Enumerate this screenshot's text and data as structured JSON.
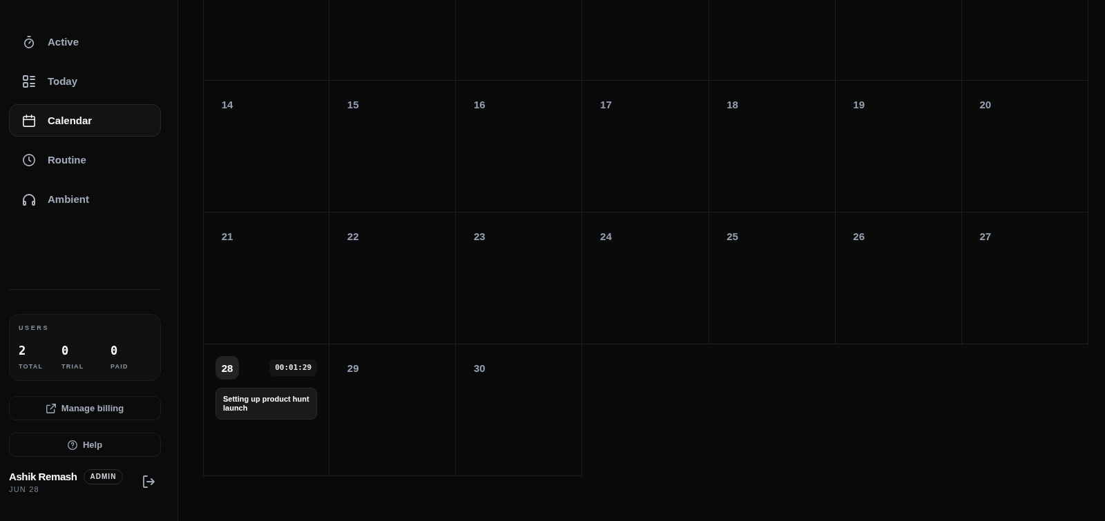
{
  "sidebar": {
    "nav": [
      {
        "label": "Active",
        "selected": false
      },
      {
        "label": "Today",
        "selected": false
      },
      {
        "label": "Calendar",
        "selected": true
      },
      {
        "label": "Routine",
        "selected": false
      },
      {
        "label": "Ambient",
        "selected": false
      }
    ],
    "users": {
      "title": "USERS",
      "stats": [
        {
          "value": "2",
          "label": "TOTAL"
        },
        {
          "value": "0",
          "label": "TRIAL"
        },
        {
          "value": "0",
          "label": "PAID"
        }
      ]
    },
    "buttons": [
      {
        "label": "Manage billing"
      },
      {
        "label": "Help"
      }
    ],
    "user": {
      "name": "Ashik Remash",
      "role": "ADMIN",
      "date": "JUN 28"
    }
  },
  "calendar": {
    "weeks": [
      {
        "days": [
          {
            "kind": "blank"
          },
          {
            "kind": "blank"
          },
          {
            "kind": "blank"
          },
          {
            "kind": "blank"
          },
          {
            "kind": "blank"
          },
          {
            "kind": "blank"
          },
          {
            "kind": "blank"
          }
        ]
      },
      {
        "days": [
          {
            "kind": "date",
            "day": "14",
            "today": false
          },
          {
            "kind": "date",
            "day": "15",
            "today": false
          },
          {
            "kind": "date",
            "day": "16",
            "today": false
          },
          {
            "kind": "date",
            "day": "17",
            "today": false
          },
          {
            "kind": "date",
            "day": "18",
            "today": false
          },
          {
            "kind": "date",
            "day": "19",
            "today": false
          },
          {
            "kind": "date",
            "day": "20",
            "today": false
          }
        ]
      },
      {
        "days": [
          {
            "kind": "date",
            "day": "21",
            "today": false
          },
          {
            "kind": "date",
            "day": "22",
            "today": false
          },
          {
            "kind": "date",
            "day": "23",
            "today": false
          },
          {
            "kind": "date",
            "day": "24",
            "today": false
          },
          {
            "kind": "date",
            "day": "25",
            "today": false
          },
          {
            "kind": "date",
            "day": "26",
            "today": false
          },
          {
            "kind": "date",
            "day": "27",
            "today": false
          }
        ]
      },
      {
        "days": [
          {
            "kind": "date",
            "day": "28",
            "today": true,
            "timer": "00:01:29",
            "events": [
              {
                "title": "Setting up product hunt launch"
              }
            ]
          },
          {
            "kind": "date",
            "day": "29",
            "today": false
          },
          {
            "kind": "date",
            "day": "30",
            "today": false
          }
        ]
      }
    ]
  }
}
